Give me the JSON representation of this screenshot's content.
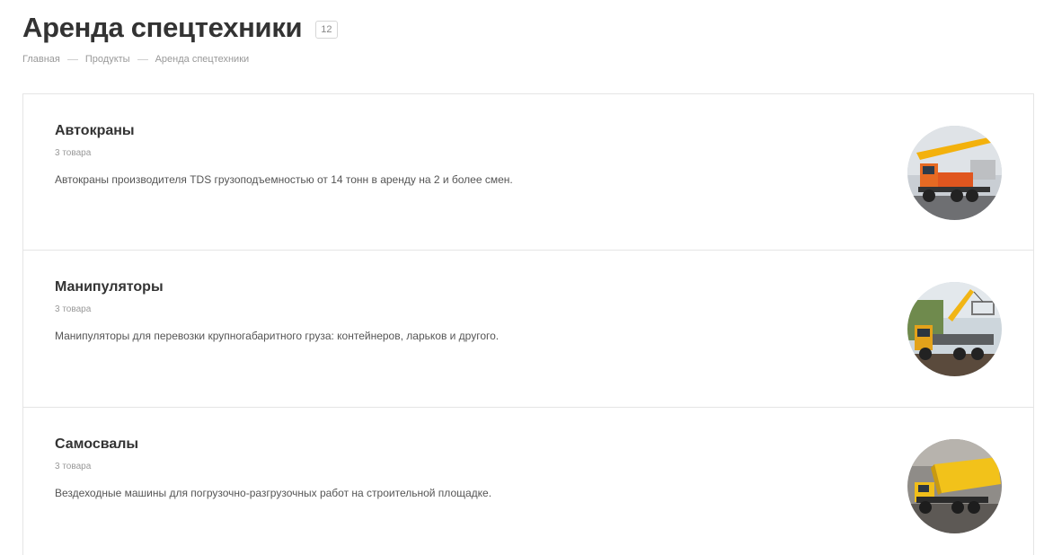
{
  "header": {
    "title": "Аренда спецтехники",
    "count": "12"
  },
  "breadcrumb": [
    {
      "label": "Главная"
    },
    {
      "label": "Продукты"
    },
    {
      "label": "Аренда спецтехники"
    }
  ],
  "items": [
    {
      "name": "Автокраны",
      "count": "3 товара",
      "description": "Автокраны производителя TDS грузоподъемностью от 14 тонн в аренду на 2 и более смен.",
      "image": "truck-crane-photo"
    },
    {
      "name": "Манипуляторы",
      "count": "3 товара",
      "description": "Манипуляторы для перевозки крупногабаритного груза: контейнеров, ларьков и другого.",
      "image": "manipulator-truck-photo"
    },
    {
      "name": "Самосвалы",
      "count": "3 товара",
      "description": "Вездеходные машины для погрузочно-разгрузочных работ на строительной площадке.",
      "image": "dump-truck-photo"
    }
  ]
}
